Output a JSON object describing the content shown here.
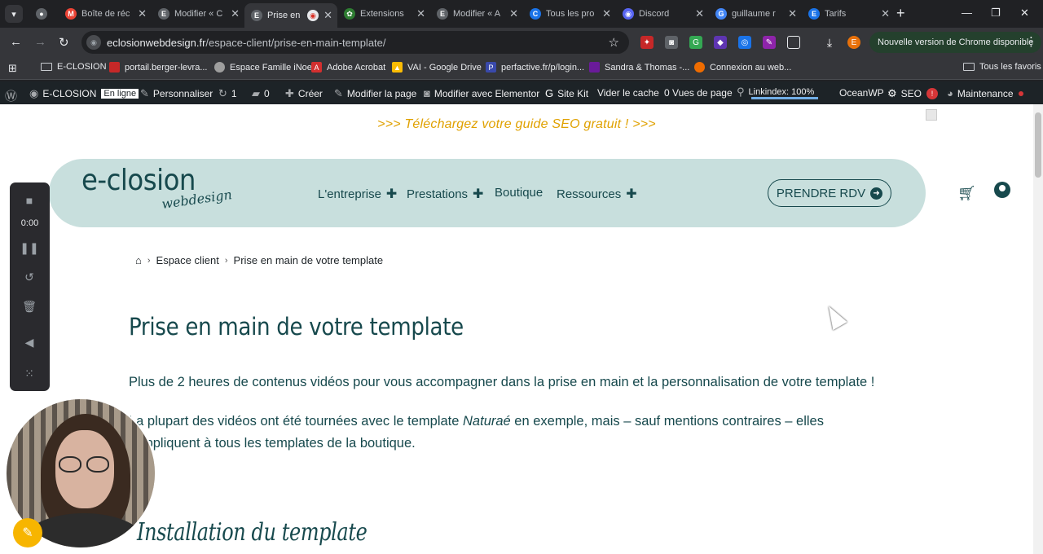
{
  "browser": {
    "tabs": [
      {
        "title": "",
        "color": "#5f6368",
        "letter": "●"
      },
      {
        "title": "Boîte de réc",
        "color": "#ea4335",
        "letter": "M"
      },
      {
        "title": "Modifier « C",
        "color": "#5f6368",
        "letter": "E"
      },
      {
        "title": "Prise en",
        "color": "#5f6368",
        "letter": "E",
        "active": true
      },
      {
        "title": "Extensions",
        "color": "#2e7d32",
        "letter": "✿"
      },
      {
        "title": "Modifier « A",
        "color": "#5f6368",
        "letter": "E"
      },
      {
        "title": "Tous les pro",
        "color": "#1a73e8",
        "letter": "C"
      },
      {
        "title": "Discord",
        "color": "#5865f2",
        "letter": "◉"
      },
      {
        "title": "guillaume r",
        "color": "#4285f4",
        "letter": "G"
      },
      {
        "title": "Tarifs",
        "color": "#1a73e8",
        "letter": "E"
      }
    ],
    "url_domain": "eclosionwebdesign.fr",
    "url_path": "/espace-client/prise-en-main-template/",
    "update_label": "Nouvelle version de Chrome disponible",
    "profile_letter": "E",
    "bookmarks": [
      {
        "label": "E-CLOSION",
        "type": "folder"
      },
      {
        "label": "portail.berger-levra...",
        "color": "#c62828"
      },
      {
        "label": "Espace Famille iNoe",
        "color": "#9e9e9e"
      },
      {
        "label": "Adobe Acrobat",
        "color": "#d32f2f"
      },
      {
        "label": "VAI - Google Drive",
        "color": "#fbbc04"
      },
      {
        "label": "perfactive.fr/p/login...",
        "color": "#3949ab"
      },
      {
        "label": "Sandra & Thomas -...",
        "color": "#6a1b9a"
      },
      {
        "label": "Connexion au web...",
        "color": "#ef6c00"
      }
    ],
    "all_bookmarks": "Tous les favoris"
  },
  "adminbar": {
    "site": "E-CLOSION",
    "online": "En ligne",
    "customize": "Personnaliser",
    "updates": "1",
    "comments": "0",
    "create": "Créer",
    "edit_page": "Modifier la page",
    "elementor": "Modifier avec Elementor",
    "sitekit": "Site Kit",
    "cache": "Vider le cache",
    "views": "0 Vues de page",
    "linkindex": "Linkindex: 100%",
    "oceanwp": "OceanWP",
    "seo": "SEO",
    "seo_alert": "!",
    "maintenance": "Maintenance"
  },
  "site": {
    "promo": ">>> Téléchargez votre guide SEO gratuit ! >>>",
    "logo_main": "e-closion",
    "logo_sub": "webdesign",
    "menu": [
      "L'entreprise",
      "Prestations",
      "Boutique",
      "Ressources"
    ],
    "cta": "PRENDRE RDV",
    "breadcrumb": [
      "Espace client",
      "Prise en main de votre template"
    ],
    "title": "Prise en main de votre template",
    "p1": "Plus de 2 heures de contenus vidéos pour vous accompagner dans la prise en main et la personnalisation de votre template !",
    "p2_a": "La plupart des vidéos ont été tournées avec le template ",
    "p2_em": "Naturaé",
    "p2_b": " en exemple, mais – sauf mentions contraires – elles s'appliquent à tous les templates de la boutique.",
    "section_title": "Installation du template"
  },
  "recorder": {
    "time": "0:00"
  },
  "colors": {
    "brand": "#17494d",
    "header_bg": "#c8dfdd",
    "promo": "#e0a100"
  }
}
